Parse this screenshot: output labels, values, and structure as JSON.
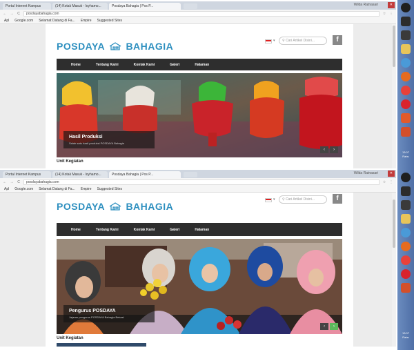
{
  "browser": {
    "tabs": [
      {
        "label": "Portal Internet Kampus"
      },
      {
        "label": "(14) Kotak Masuk - loyhamo..."
      },
      {
        "label": "Posdaya Bahagia | Pos P..."
      }
    ],
    "url": "posdayabahagia.com",
    "bookmarks": [
      {
        "label": "Apl"
      },
      {
        "label": "Google.com"
      },
      {
        "label": "Selamat Datang di Fa..."
      },
      {
        "label": "Empire"
      },
      {
        "label": "Suggested Sites"
      }
    ],
    "window_user": "Wilda Ratnasari"
  },
  "site": {
    "logo_left": "POSDAYA",
    "logo_right": "BAHAGIA",
    "search_placeholder": "Cari Artikel Disini...",
    "facebook": "f",
    "nav": [
      {
        "label": "Home"
      },
      {
        "label": "Tentang Kami"
      },
      {
        "label": "Kontak Kami"
      },
      {
        "label": "Galeri"
      },
      {
        "label": "Halaman"
      }
    ]
  },
  "screen1": {
    "slide_title": "Hasil Produksi",
    "slide_sub": "Salah satu hasil produksi POSDAYA Bahagia",
    "section_title": "Unit Kegiatan"
  },
  "screen2": {
    "slide_title": "Pengurus POSDAYA",
    "slide_sub": "Jajaran pengurus POSDAYA Bahagia Bekasi",
    "section_title": "Unit Kegiatan"
  },
  "taskbar": {
    "time": "13:07",
    "day": "Rabu",
    "icons": [
      {
        "name": "skype",
        "color": "#2c2c2c"
      },
      {
        "name": "mail",
        "color": "#3a3a3a"
      },
      {
        "name": "folder",
        "color": "#e8c55a"
      },
      {
        "name": "globe",
        "color": "#4a9ad8"
      },
      {
        "name": "firefox",
        "color": "#e66b1f"
      },
      {
        "name": "chrome",
        "color": "#e8413a"
      },
      {
        "name": "opera",
        "color": "#d9232d"
      },
      {
        "name": "media",
        "color": "#e15a2a"
      },
      {
        "name": "presentation",
        "color": "#d34f2a"
      }
    ]
  }
}
